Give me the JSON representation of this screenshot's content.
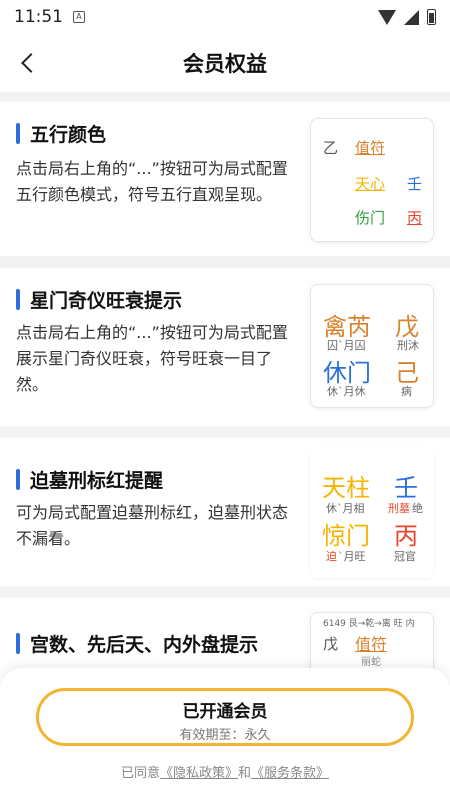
{
  "status": {
    "time": "11:51",
    "a_icon": "A"
  },
  "header": {
    "title": "会员权益"
  },
  "cards": [
    {
      "title": "五行颜色",
      "desc": "点击局右上角的“...”按钮可为局式配置五行颜色模式，符号五行直观呈现。",
      "demo": {
        "c1": "乙",
        "c2": "值符",
        "c3": "天心",
        "c4": "壬",
        "c5": "伤门",
        "c6": "丙"
      }
    },
    {
      "title": "星门奇仪旺衰提示",
      "desc": "点击局右上角的“...”按钮可为局式配置展示星门奇仪旺衰，符号旺衰一目了然。",
      "demo": {
        "b1": "禽芮",
        "s1": "囚`月囚",
        "b2": "戊",
        "s2": "刑沐",
        "b3": "休门",
        "s3": "休`月休",
        "b4": "己",
        "s4": "病"
      }
    },
    {
      "title": "迫墓刑标红提醒",
      "desc": "可为局式配置迫墓刑标红，迫墓刑状态不漏看。",
      "demo": {
        "b1": "天柱",
        "s1": "休`月相",
        "b2": "壬",
        "s2a": "刑墓",
        "s2b": "绝",
        "b3": "惊门",
        "s3a": "迫",
        "s3b": "`月旺",
        "b4": "丙",
        "s4": "冠官"
      }
    },
    {
      "title": "宫数、先后天、内外盘提示",
      "demo": {
        "top": "6149 艮→乾→离 旺 内",
        "c1": "戊",
        "c2": "值符",
        "c3": "丽蛇"
      }
    }
  ],
  "bottom": {
    "btn_main": "已开通会员",
    "btn_sub": "有效期至：永久",
    "agree_prefix": "已同意",
    "privacy": "《隐私政策》",
    "and": "和",
    "terms": "《服务条款》"
  },
  "colors": {
    "accent": "#2a6fdb",
    "gold": "#f2b531",
    "fire": "#e8452c",
    "earth": "#d9822b",
    "wood": "#2e9e3e",
    "water": "#2a6fdb",
    "metal_yellow": "#f5b400"
  }
}
